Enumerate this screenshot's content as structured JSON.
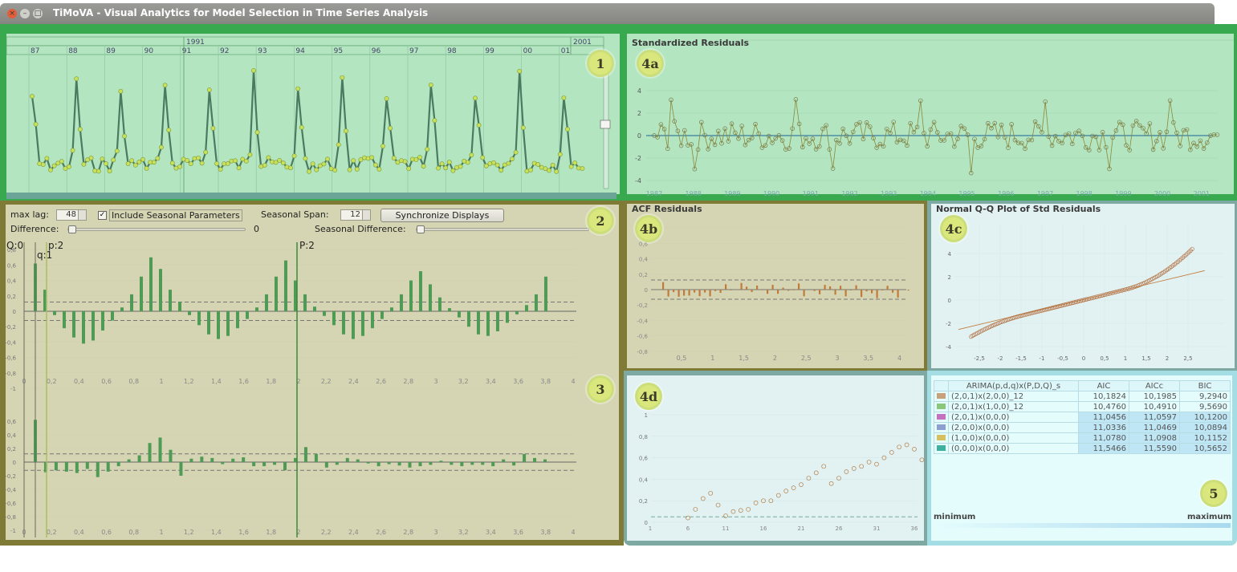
{
  "window": {
    "title": "TiMoVA - Visual Analytics for Model Selection in Time Series Analysis"
  },
  "badges": {
    "b1": "1",
    "b2": "2",
    "b3": "3",
    "b4a": "4a",
    "b4b": "4b",
    "b4c": "4c",
    "b4d": "4d",
    "b5": "5"
  },
  "timeseries": {
    "decade_labels": [
      "1991",
      "2001"
    ],
    "year_labels": [
      "87",
      "88",
      "89",
      "90",
      "91",
      "92",
      "93",
      "94",
      "95",
      "96",
      "97",
      "98",
      "99",
      "00",
      "01"
    ]
  },
  "controls": {
    "max_lag_label": "max lag:",
    "max_lag_value": "48",
    "include_seasonal_label": "Include Seasonal Parameters",
    "include_seasonal_checked": true,
    "seasonal_span_label": "Seasonal Span:",
    "seasonal_span_value": "12",
    "sync_button": "Synchronize Displays",
    "difference_label": "Difference:",
    "difference_value": "0",
    "seasonal_difference_label": "Seasonal Difference:"
  },
  "acf_panel": {
    "markers": [
      "Q:0",
      "p:2",
      "q:1",
      "P:2"
    ],
    "y_ticks": [
      "1",
      "0,8",
      "0,6",
      "0,4",
      "0,2",
      "0",
      "-0,2",
      "-0,4",
      "-0,6",
      "-0,8",
      "-1"
    ],
    "x_ticks": [
      "0",
      "0,2",
      "0,4",
      "0,6",
      "0,8",
      "1",
      "1,2",
      "1,4",
      "1,6",
      "1,8",
      "2",
      "2,2",
      "2,4",
      "2,6",
      "2,8",
      "3",
      "3,2",
      "3,4",
      "3,6",
      "3,8",
      "4"
    ],
    "acf_values": [
      0.62,
      0.28,
      -0.05,
      -0.22,
      -0.34,
      -0.42,
      -0.38,
      -0.25,
      -0.12,
      0.05,
      0.22,
      0.45,
      0.7,
      0.55,
      0.28,
      0.12,
      -0.05,
      -0.18,
      -0.3,
      -0.36,
      -0.32,
      -0.22,
      -0.1,
      0.05,
      0.22,
      0.45,
      0.66,
      0.4,
      0.22,
      0.06,
      -0.06,
      -0.18,
      -0.3,
      -0.36,
      -0.32,
      -0.22,
      -0.1,
      0.05,
      0.22,
      0.4,
      0.52,
      0.35,
      0.18,
      0.04,
      -0.08,
      -0.2,
      -0.3,
      -0.32,
      -0.26,
      -0.15,
      -0.04,
      0.08,
      0.22,
      0.45
    ],
    "pacf_values": [
      0.62,
      -0.15,
      -0.12,
      -0.14,
      -0.16,
      -0.1,
      -0.22,
      -0.14,
      -0.06,
      0.04,
      0.1,
      0.28,
      0.36,
      0.18,
      -0.2,
      0.05,
      0.08,
      0.06,
      -0.03,
      0.05,
      0.07,
      -0.06,
      -0.06,
      -0.04,
      -0.12,
      0.06,
      0.22,
      0.12,
      -0.08,
      -0.04,
      0.06,
      0.04,
      -0.02,
      -0.06,
      -0.03,
      -0.05,
      -0.08,
      -0.06,
      -0.04,
      0.02,
      -0.04,
      -0.06,
      -0.04,
      -0.04,
      -0.06,
      0.04,
      -0.05,
      0.12,
      0.06,
      0.04
    ],
    "conf_level": 0.12
  },
  "std_residuals": {
    "title": "Standardized Residuals",
    "y_ticks": [
      "4",
      "2",
      "0",
      "-2",
      "-4"
    ],
    "x_ticks": [
      "1987",
      "1988",
      "1989",
      "1990",
      "1991",
      "1992",
      "1993",
      "1994",
      "1995",
      "1996",
      "1997",
      "1998",
      "1999",
      "2000",
      "2001"
    ]
  },
  "acf_residuals": {
    "title": "ACF Residuals",
    "y_ticks": [
      "0,8",
      "0,6",
      "0,4",
      "0,2",
      "0",
      "-0,2",
      "-0,4",
      "-0,6",
      "-0,8"
    ],
    "x_ticks": [
      "0,5",
      "1",
      "1,5",
      "2",
      "2,5",
      "3",
      "3,5",
      "4"
    ]
  },
  "qq_plot": {
    "title": "Normal Q-Q Plot of Std Residuals",
    "y_ticks": [
      "4",
      "2",
      "0",
      "-2",
      "-4"
    ],
    "x_ticks": [
      "-2,5",
      "-2",
      "-1,5",
      "-1",
      "-0,5",
      "0",
      "0,5",
      "1",
      "1,5",
      "2",
      "2,5"
    ]
  },
  "ljung_box": {
    "y_ticks": [
      "1",
      "0,8",
      "0,6",
      "0,4",
      "0,2",
      "0"
    ],
    "x_ticks": [
      "1",
      "6",
      "11",
      "16",
      "21",
      "26",
      "31",
      "36"
    ]
  },
  "model_table": {
    "headers": [
      "ARIMA(p,d,q)x(P,D,Q)_s",
      "AIC",
      "AICc",
      "BIC"
    ],
    "rows": [
      {
        "model": "(2,0,1)x(2,0,0)_12",
        "aic": "10,1824",
        "aicc": "10,1985",
        "bic": "9,2940",
        "color": "#c8a07c"
      },
      {
        "model": "(2,0,1)x(1,0,0)_12",
        "aic": "10,4760",
        "aicc": "10,4910",
        "bic": "9,5690",
        "color": "#8bc77a"
      },
      {
        "model": "(2,0,1)x(0,0,0)",
        "aic": "11,0456",
        "aicc": "11,0597",
        "bic": "10,1200",
        "color": "#c472c0"
      },
      {
        "model": "(2,0,0)x(0,0,0)",
        "aic": "11,0336",
        "aicc": "11,0469",
        "bic": "10,0894",
        "color": "#8c9fd0"
      },
      {
        "model": "(1,0,0)x(0,0,0)",
        "aic": "11,0780",
        "aicc": "11,0908",
        "bic": "10,1152",
        "color": "#d6c060"
      },
      {
        "model": "(0,0,0)x(0,0,0)",
        "aic": "11,5466",
        "aicc": "11,5590",
        "bic": "10,5652",
        "color": "#3fb0a0"
      }
    ],
    "legend_min": "minimum",
    "legend_max": "maximum"
  }
}
